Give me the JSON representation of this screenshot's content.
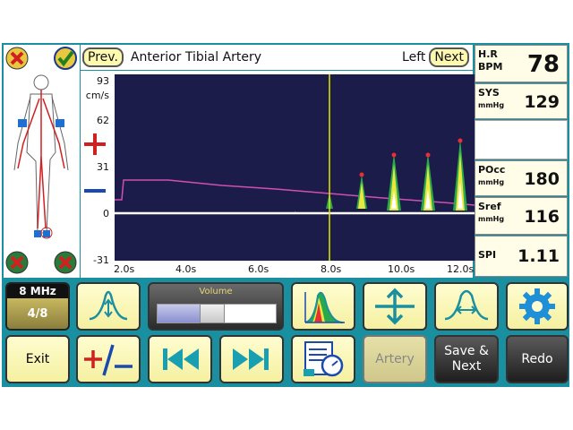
{
  "header": {
    "prev_label": "Prev.",
    "artery_title": "Anterior Tibial Artery",
    "side_label": "Left",
    "next_label": "Next"
  },
  "plot": {
    "y_unit": "cm/s",
    "y_ticks": [
      "93",
      "62",
      "31",
      "0",
      "-31"
    ],
    "x_ticks": [
      "2.0s",
      "4.0s",
      "6.0s",
      "8.0s",
      "10.0s",
      "12.0s"
    ],
    "colors": {
      "background": "#1b1c4a",
      "trace": "#d04fb0",
      "baseline": "#ffffff",
      "cursor": "#e6e600"
    }
  },
  "vitals": [
    {
      "name": "H.R",
      "unit": "BPM",
      "value": "78"
    },
    {
      "name": "SYS",
      "unit": "mmHg",
      "value": "129"
    },
    {
      "name": "POcc",
      "unit": "mmHg",
      "value": "180"
    },
    {
      "name": "Sref",
      "unit": "mmHg",
      "value": "116"
    },
    {
      "name": "SPI",
      "unit": "",
      "value": "1.11"
    }
  ],
  "controls": {
    "frequency": "8 MHz",
    "depth": "4/8",
    "volume_label": "Volume",
    "volume_level": 0.45,
    "exit_label": "Exit",
    "artery_label": "Artery",
    "save_next_label": "Save & Next",
    "redo_label": "Redo"
  },
  "icons": [
    "close-icon",
    "check-icon",
    "body-diagram",
    "plus-icon",
    "minus-icon",
    "waveform-icon",
    "spectrum-icon",
    "expand-vertical-icon",
    "waveform-width-icon",
    "gear-icon",
    "plus-minus-icon",
    "skip-back-icon",
    "skip-forward-icon",
    "report-icon"
  ]
}
